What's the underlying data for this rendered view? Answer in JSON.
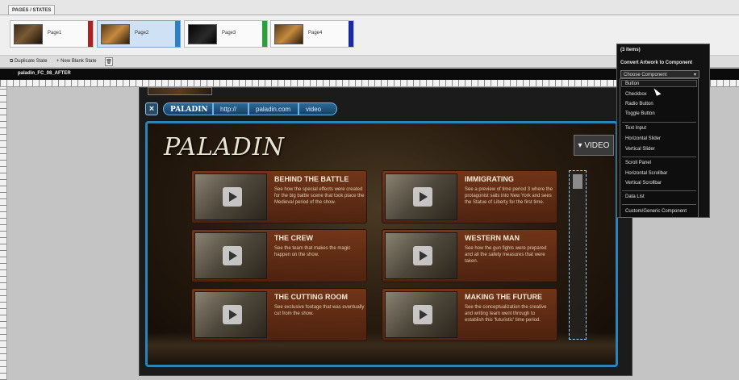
{
  "pages_panel": {
    "tab_label": "PAGES / STATES",
    "pages": [
      {
        "label": "Page1",
        "color": "#b01f22"
      },
      {
        "label": "Page2",
        "color": "#2d7fc7"
      },
      {
        "label": "Page3",
        "color": "#2aa136"
      },
      {
        "label": "Page4",
        "color": "#1a2aa0"
      }
    ]
  },
  "state_toolbar": {
    "duplicate": "Duplicate State",
    "new_blank": "New Blank State"
  },
  "document": {
    "title": "paladin_FC_08_AFTER"
  },
  "site": {
    "nav": {
      "logo": "PALADIN",
      "protocol": "http://",
      "domain": "paladin.com",
      "section": "video"
    },
    "logo": "PALADIN",
    "video_button": "VIDEO",
    "cards": [
      {
        "title": "BEHIND THE BATTLE",
        "desc": "See how the special effects were created for the big battle scene that took place the Medieval period of the show."
      },
      {
        "title": "IMMIGRATING",
        "desc": "See a preview of time period 3 where the protagonist sails into New York and sees the Statue of Liberty for the first time."
      },
      {
        "title": "THE CREW",
        "desc": "See the team that makes the magic happen on the show."
      },
      {
        "title": "WESTERN MAN",
        "desc": "See how the gun fights were prepared and all the safety measures that were taken."
      },
      {
        "title": "THE CUTTING ROOM",
        "desc": "See exclusive footage that was eventually cut from the show."
      },
      {
        "title": "MAKING THE FUTURE",
        "desc": "See the conceptualization the creative and writing team went through to establish this 'futuristic' time period."
      }
    ]
  },
  "convert_panel": {
    "count": "(3 items)",
    "heading": "Convert Artwork to Component",
    "select_value": "Choose Component",
    "menu_items": [
      "Button",
      "Checkbox",
      "Radio Button",
      "Toggle Button",
      "Text Input",
      "Horizontal Slider",
      "Vertical Slider",
      "Scroll Panel",
      "Horizontal Scrollbar",
      "Vertical Scrollbar",
      "Data List",
      "Custom/Generic Component"
    ]
  }
}
